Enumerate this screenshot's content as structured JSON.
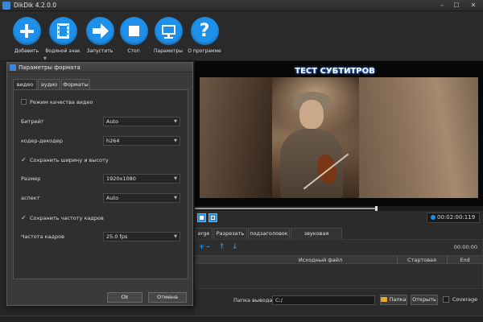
{
  "window": {
    "title": "DikDik 4.2.0.0",
    "controls": {
      "minimize": "–",
      "maximize": "☐",
      "close": "✕"
    }
  },
  "toolbar": {
    "buttons": [
      {
        "label": "Добавить",
        "icon": "plus-icon"
      },
      {
        "label": "Водяной знак",
        "icon": "film-icon"
      },
      {
        "label": "Запустить",
        "icon": "arrow-right-icon"
      },
      {
        "label": "Стоп",
        "icon": "stop-icon"
      },
      {
        "label": "Параметры",
        "icon": "monitor-icon"
      },
      {
        "label": "О программе",
        "icon": "question-icon"
      }
    ],
    "accent": "#1e90ea"
  },
  "preview": {
    "subtitle": "ТЕСТ СУБТИТРОВ",
    "progress": 0.63,
    "time": "00:02:00:119"
  },
  "bottom_tabs": {
    "items": [
      "erge",
      "Разрезать",
      "подзаголовок",
      "звуковая дорожка"
    ],
    "active": 0
  },
  "segments": {
    "time": "00:00:00",
    "columns": [
      "Исходный файл",
      "Стартовая",
      "End"
    ]
  },
  "output": {
    "folder_label": "Папка вывода",
    "folder_value": "C:/",
    "folder_button": "Папка",
    "open_button": "Открыть",
    "coverage_label": "Coverage"
  },
  "dialog": {
    "title": "Параметры формата",
    "tabs": [
      "видео",
      "аудио",
      "Форматы"
    ],
    "active_tab": 0,
    "quality_mode_label": "Режим качества видео",
    "bitrate_label": "Битрейт",
    "bitrate_value": "Auto",
    "codec_label": "кодер-декодер",
    "codec_value": "h264",
    "keep_size_label": "Сохранить ширину и высоту",
    "keep_size_mark": "✓",
    "size_label": "Размер",
    "size_value": "1920x1080",
    "aspect_label": "аспект",
    "aspect_value": "Auto",
    "keep_fps_label": "Сохранить частоту кадров",
    "keep_fps_mark": "✓",
    "fps_label": "Частота кадров",
    "fps_value": "25.0 fps",
    "ok_label": "Ok",
    "cancel_label": "Отмена"
  }
}
